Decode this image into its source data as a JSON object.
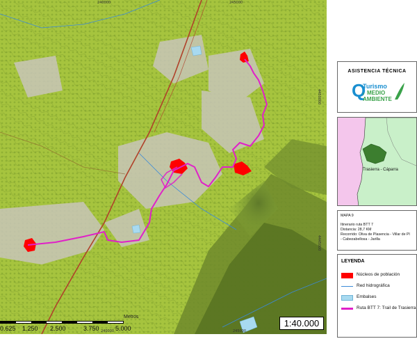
{
  "map": {
    "coords_top": [
      "240000",
      "245000"
    ],
    "coords_bottom": [
      "240000",
      "245000"
    ],
    "coords_right": [
      "4450000",
      "4445000"
    ],
    "scale_bar": {
      "unit": "Metros",
      "labels": [
        "0.625",
        "1.250",
        "2.500",
        "3.750",
        "5.000"
      ]
    },
    "scale_text": "1:40.000"
  },
  "logo_box": {
    "header": "ASISTENCIA TÉCNICA",
    "logo_line1": "Turismo",
    "logo_line2": "MEDIO",
    "logo_line3": "AMBIENTE",
    "logo_small": "y"
  },
  "locator": {
    "region_label": "Trasierra - Cáparra"
  },
  "info": {
    "map_number": "MAPA 9",
    "itinerary": "Itinerario ruta BTT 7",
    "distance": "Distancia: 28,7 KM",
    "route": "Recorrido: Oliva de Plasencia - Villar de Pl",
    "route2": "- Cabezabellosa - Jarilla"
  },
  "legend": {
    "title": "LEYENDA",
    "items": [
      {
        "label": "Núcleos de población",
        "color": "#ff0000",
        "kind": "box"
      },
      {
        "label": "Red hidrográfica",
        "color": "#3b8ad9",
        "kind": "line"
      },
      {
        "label": "Embalses",
        "color": "#a8daf0",
        "kind": "box"
      },
      {
        "label": "Ruta BTT 7: Trail de Trasierra",
        "color": "#e020c8",
        "kind": "thick"
      }
    ]
  },
  "colors": {
    "terrain": "#9fbf3a",
    "urban": "#ff0000",
    "route": "#e020c8",
    "water": "#a8daf0",
    "road": "#b0412a"
  }
}
